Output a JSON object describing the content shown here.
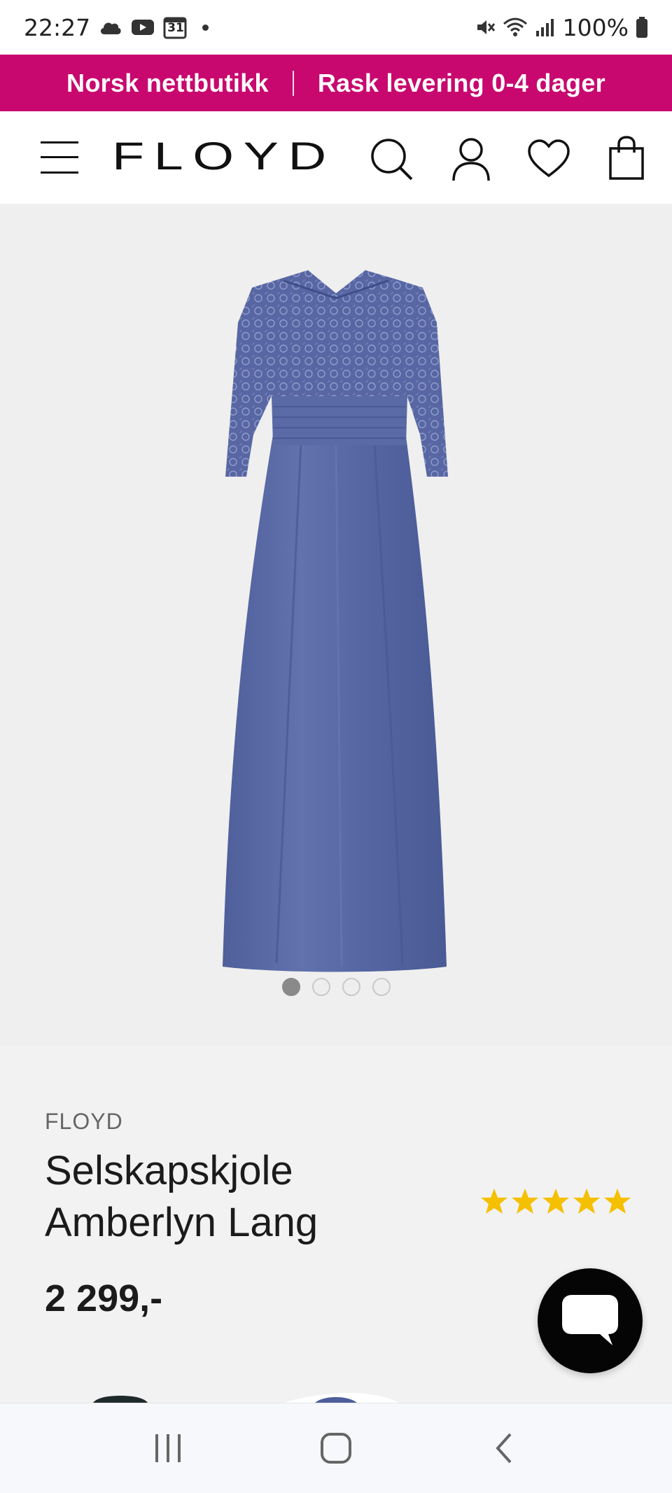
{
  "status_bar": {
    "time": "22:27",
    "calendar_day": "31",
    "battery": "100%"
  },
  "promo": {
    "left_text": "Norsk nettbutikk",
    "right_text": "Rask levering 0-4 dager"
  },
  "header": {
    "logo": "FLOYD"
  },
  "gallery": {
    "image_count": 4,
    "active_index": 0
  },
  "product": {
    "brand": "FLOYD",
    "title": "Selskapskjole Amberlyn Lang",
    "price": "2 299,-",
    "rating": 5,
    "rating_max": 5
  },
  "colors": {
    "accent": "#c8086f",
    "star": "#f5c000",
    "dress": "#5a6aa6"
  },
  "icons": {
    "menu": "hamburger-icon",
    "search": "search-icon",
    "account": "user-icon",
    "wishlist": "heart-icon",
    "cart": "bag-icon",
    "chat": "chat-icon"
  }
}
